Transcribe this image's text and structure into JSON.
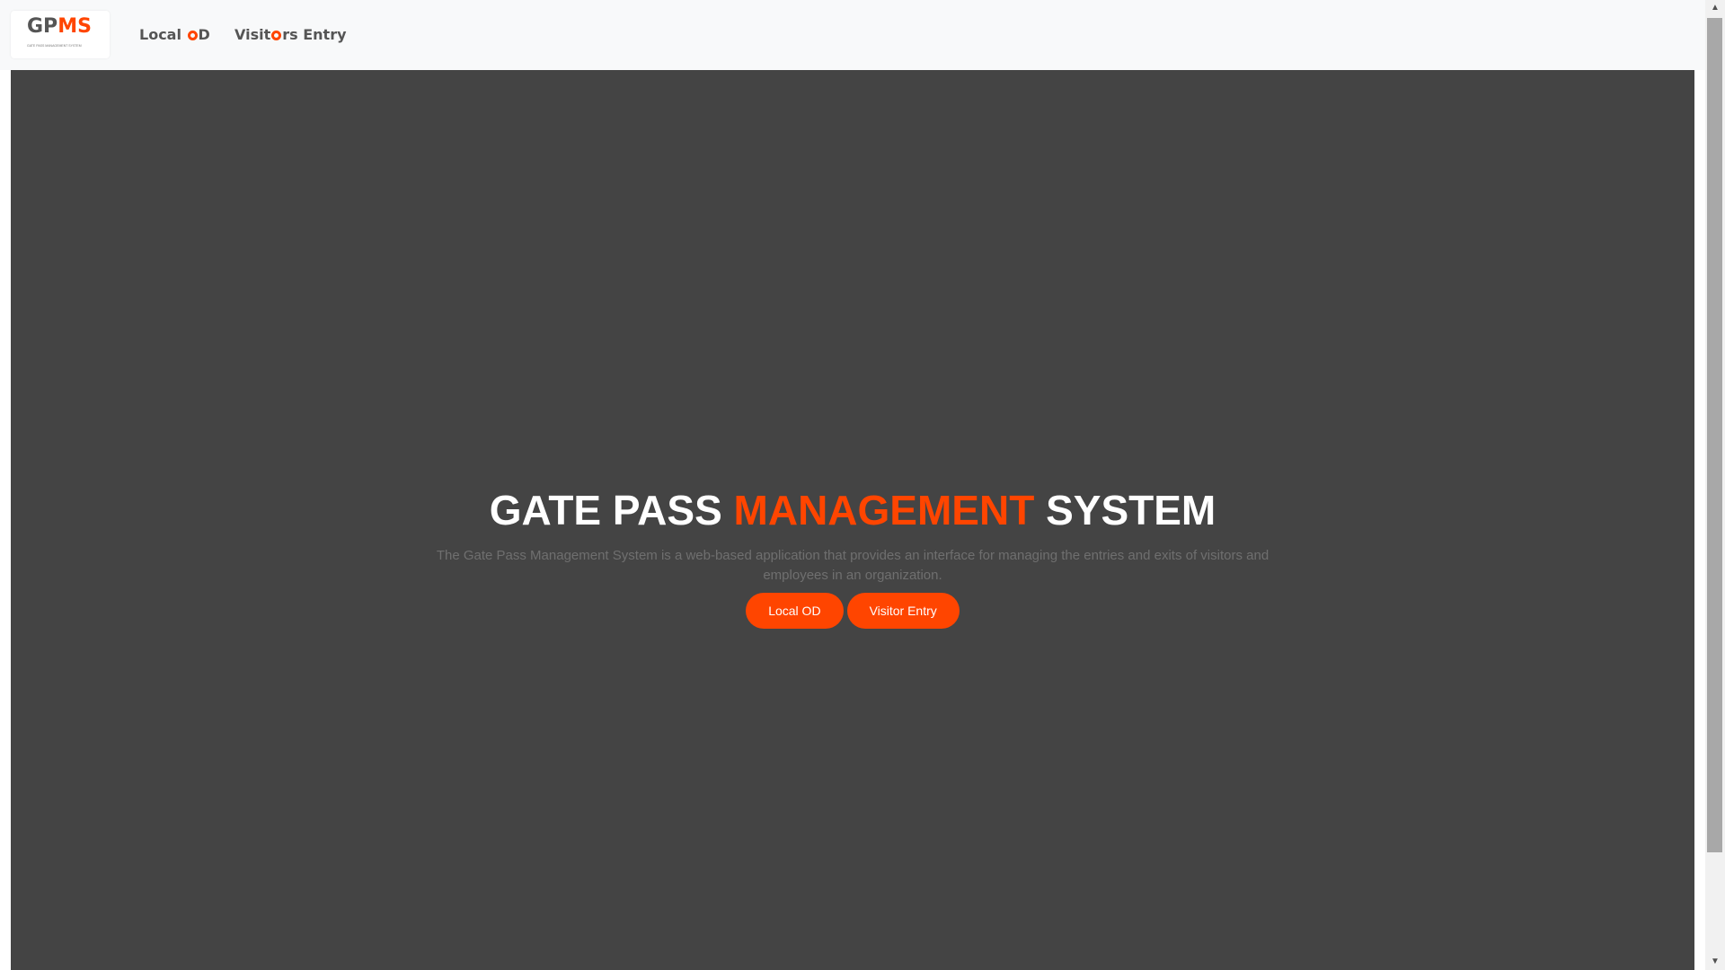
{
  "brand": {
    "logo_part1": "GP",
    "logo_part2": "MS",
    "logo_tagline": "GATE PASS MANAGEMENT SYSTEM"
  },
  "nav": {
    "local_od": {
      "before": "Local ",
      "after": "D"
    },
    "visitors_entry": {
      "before": "Visit",
      "after": "rs Entry"
    }
  },
  "hero": {
    "title_part1": "GATE PASS ",
    "title_accent": "MANAGEMENT",
    "title_part2": " SYSTEM",
    "description": "The Gate Pass Management System is a web-based application that provides an interface for managing the entries and exits of visitors and employees in an organization.",
    "buttons": {
      "local_od": "Local OD",
      "visitor_entry": "Visitor Entry"
    }
  },
  "colors": {
    "accent": "#ff4500",
    "hero_background": "#444444",
    "navbar_background": "#f8f9fa"
  },
  "icons": {
    "scroll_up": "triangle-up-icon",
    "scroll_down": "triangle-down-icon"
  }
}
